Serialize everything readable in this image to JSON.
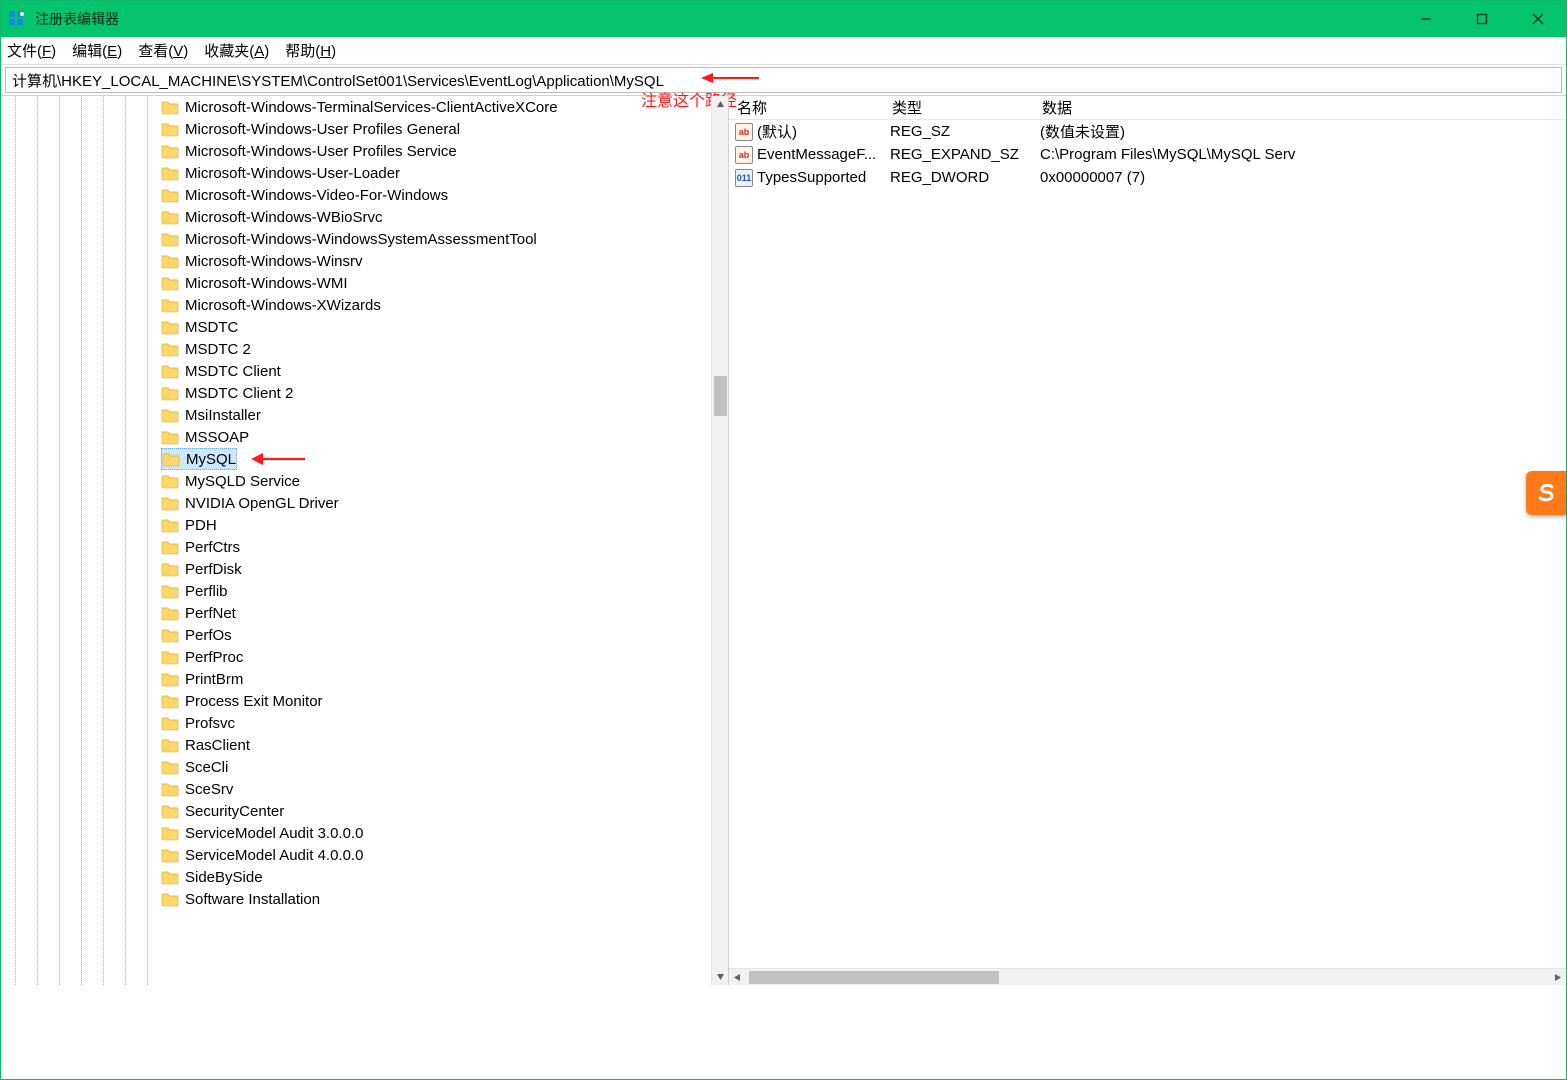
{
  "window": {
    "title": "注册表编辑器"
  },
  "menu": {
    "file": "文件(F)",
    "edit": "编辑(E)",
    "view": "查看(V)",
    "favorites": "收藏夹(A)",
    "help": "帮助(H)"
  },
  "address": {
    "path": "计算机\\HKEY_LOCAL_MACHINE\\SYSTEM\\ControlSet001\\Services\\EventLog\\Application\\MySQL"
  },
  "annotations": {
    "path_note": "注意这个路径"
  },
  "tree": {
    "items": [
      "Microsoft-Windows-TerminalServices-ClientActiveXCore",
      "Microsoft-Windows-User Profiles General",
      "Microsoft-Windows-User Profiles Service",
      "Microsoft-Windows-User-Loader",
      "Microsoft-Windows-Video-For-Windows",
      "Microsoft-Windows-WBioSrvc",
      "Microsoft-Windows-WindowsSystemAssessmentTool",
      "Microsoft-Windows-Winsrv",
      "Microsoft-Windows-WMI",
      "Microsoft-Windows-XWizards",
      "MSDTC",
      "MSDTC 2",
      "MSDTC Client",
      "MSDTC Client 2",
      "MsiInstaller",
      "MSSOAP",
      "MySQL",
      "MySQLD Service",
      "NVIDIA OpenGL Driver",
      "PDH",
      "PerfCtrs",
      "PerfDisk",
      "Perflib",
      "PerfNet",
      "PerfOs",
      "PerfProc",
      "PrintBrm",
      "Process Exit Monitor",
      "Profsvc",
      "RasClient",
      "SceCli",
      "SceSrv",
      "SecurityCenter",
      "ServiceModel Audit 3.0.0.0",
      "ServiceModel Audit 4.0.0.0",
      "SideBySide",
      "Software Installation"
    ],
    "selected_index": 16
  },
  "list": {
    "columns": {
      "name": "名称",
      "type": "类型",
      "data": "数据"
    },
    "rows": [
      {
        "icon": "str",
        "name": "(默认)",
        "type": "REG_SZ",
        "data": "(数值未设置)"
      },
      {
        "icon": "str",
        "name": "EventMessageF...",
        "type": "REG_EXPAND_SZ",
        "data": "C:\\Program Files\\MySQL\\MySQL Serv"
      },
      {
        "icon": "bin",
        "name": "TypesSupported",
        "type": "REG_DWORD",
        "data": "0x00000007 (7)"
      }
    ]
  }
}
